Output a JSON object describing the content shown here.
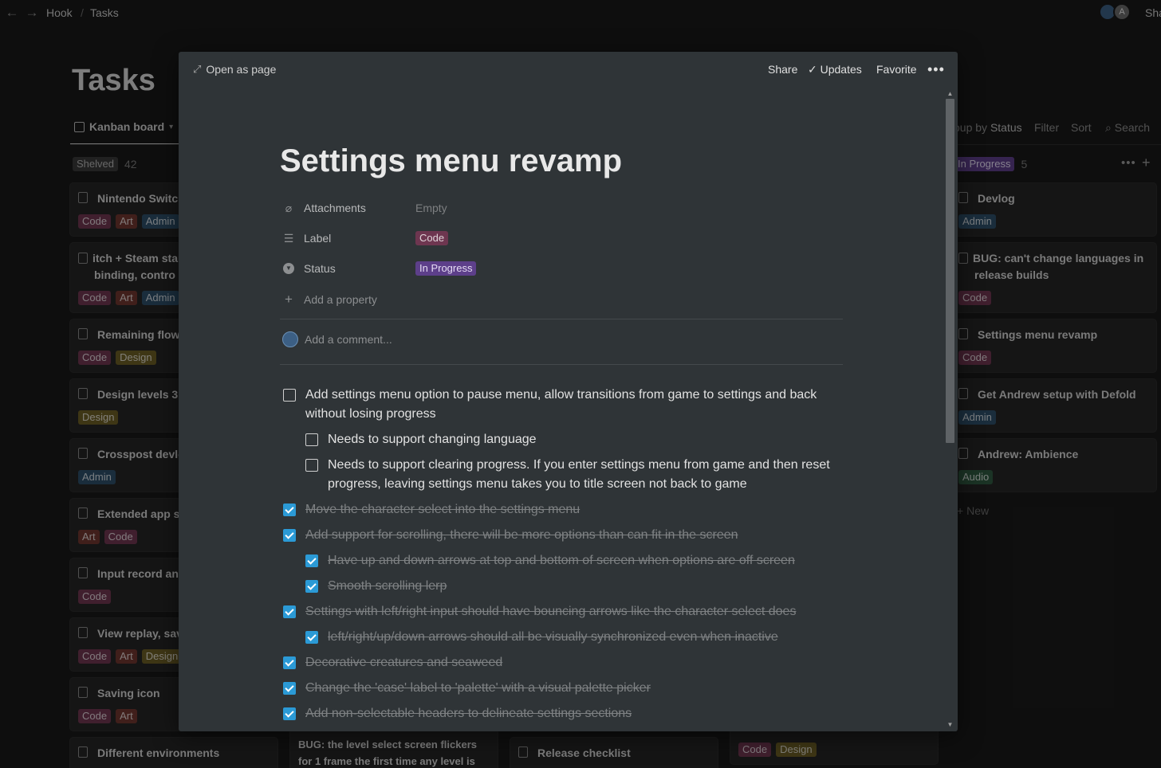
{
  "topbar": {
    "breadcrumbs": [
      "Hook",
      "Tasks"
    ],
    "avatar_letter": "A",
    "share_label": "Sha"
  },
  "board": {
    "title": "Tasks",
    "view_label": "Kanban board",
    "group_by_label": "oup by",
    "group_by_value": "Status",
    "filter_label": "Filter",
    "sort_label": "Sort",
    "search_label": "Search",
    "columns": [
      {
        "name": "Shelved",
        "count": "42",
        "cards": [
          {
            "title": "Nintendo Switch",
            "tags": [
              "Code",
              "Art",
              "Admin"
            ]
          },
          {
            "title": "itch + Steam star (key binding, contro",
            "tags": [
              "Code",
              "Art",
              "Admin"
            ]
          },
          {
            "title": "Remaining flow w",
            "tags": [
              "Code",
              "Design"
            ]
          },
          {
            "title": "Design levels 31-",
            "tags": [
              "Design"
            ]
          },
          {
            "title": "Crosspost devlog",
            "tags": [
              "Admin"
            ]
          },
          {
            "title": "Extended app sta",
            "tags": [
              "Art",
              "Code"
            ]
          },
          {
            "title": "Input record and",
            "tags": [
              "Code"
            ]
          },
          {
            "title": "View replay, save",
            "tags": [
              "Code",
              "Art",
              "Design"
            ]
          },
          {
            "title": "Saving icon",
            "tags": [
              "Code",
              "Art"
            ]
          },
          {
            "title": "Different environments",
            "tags": []
          }
        ]
      },
      {
        "name": "",
        "cards": [
          {
            "title": "BUG: the level select screen flickers for 1 frame the first time any level is",
            "tags": []
          }
        ]
      },
      {
        "name": "",
        "cards": [
          {
            "title": "Release checklist",
            "tags": []
          }
        ]
      },
      {
        "name": "",
        "cards": [
          {
            "title": "",
            "tags": [
              "Code",
              "Design"
            ]
          }
        ]
      },
      {
        "name": "In Progress",
        "count": "5",
        "cards": [
          {
            "title": "Devlog",
            "tags": [
              "Admin"
            ]
          },
          {
            "title": "BUG: can't change languages in release builds",
            "tags": [
              "Code"
            ]
          },
          {
            "title": "Settings menu revamp",
            "tags": [
              "Code"
            ]
          },
          {
            "title": "Get Andrew setup with Defold",
            "tags": [
              "Admin"
            ]
          },
          {
            "title": "Andrew: Ambience",
            "tags": [
              "Audio"
            ]
          }
        ],
        "new_label": "New"
      }
    ]
  },
  "modal": {
    "open_as_page": "Open as page",
    "share": "Share",
    "updates": "Updates",
    "favorite": "Favorite",
    "title": "Settings menu revamp",
    "properties": [
      {
        "name": "Attachments",
        "value": "Empty",
        "icon": "paperclip-icon"
      },
      {
        "name": "Label",
        "value": "Code",
        "icon": "list-icon"
      },
      {
        "name": "Status",
        "value": "In Progress",
        "icon": "status-icon"
      }
    ],
    "add_property": "Add a property",
    "add_comment": "Add a comment...",
    "todos": [
      {
        "text": "Add settings menu option to pause menu, allow transitions from game to settings and back without losing progress",
        "done": false,
        "indent": 0
      },
      {
        "text": "Needs to support changing language",
        "done": false,
        "indent": 1
      },
      {
        "text": "Needs to support clearing progress. If you enter settings menu from game and then reset progress, leaving settings menu takes you to title screen not back to game",
        "done": false,
        "indent": 1
      },
      {
        "text": "Move the character select into the settings menu",
        "done": true,
        "indent": 0
      },
      {
        "text": "Add support for scrolling, there will be more options than can fit in the screen",
        "done": true,
        "indent": 0
      },
      {
        "text": "Have up and down arrows at top and bottom of screen when options are off screen",
        "done": true,
        "indent": 1
      },
      {
        "text": "Smooth scrolling lerp",
        "done": true,
        "indent": 1
      },
      {
        "text": "Settings with left/right input should have bouncing arrows like the character select does",
        "done": true,
        "indent": 0
      },
      {
        "text": "left/right/up/down arrows should all be visually synchronized even when inactive",
        "done": true,
        "indent": 1
      },
      {
        "text": "Decorative creatures and seaweed",
        "done": true,
        "indent": 0
      },
      {
        "text": "Change the 'case' label to 'palette' with a visual palette picker",
        "done": true,
        "indent": 0
      },
      {
        "text": "Add non-selectable headers to delineate settings sections",
        "done": true,
        "indent": 0
      }
    ]
  },
  "colors": {
    "background": "#191919",
    "modal_bg": "#2f3437",
    "checkbox_checked": "#2b9ad6",
    "status_in_progress": "#5d3f8a",
    "label_code": "#6e3650"
  }
}
